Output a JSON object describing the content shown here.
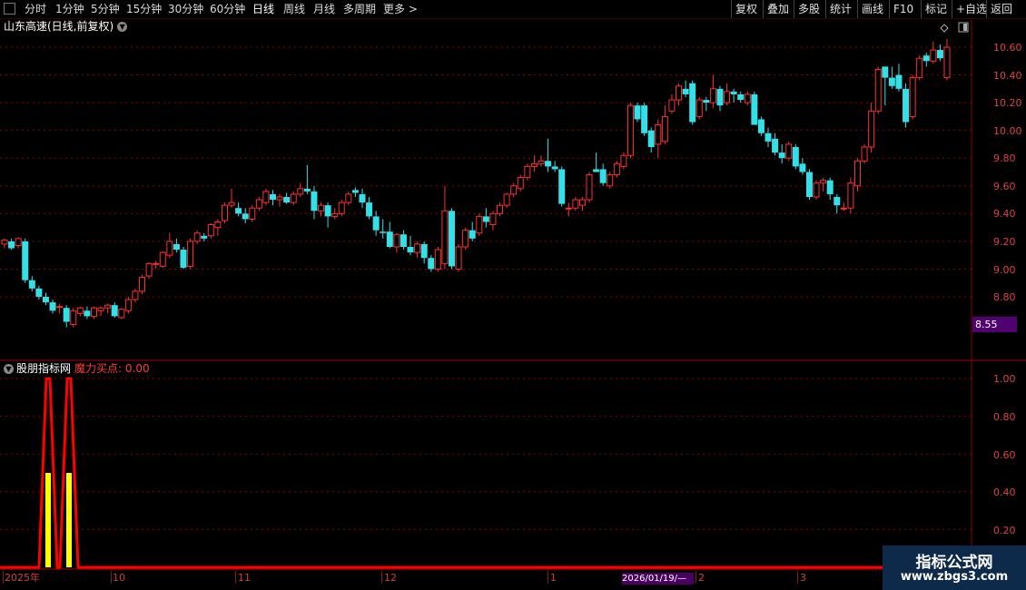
{
  "toolbar": {
    "periods": [
      "分时",
      "1分钟",
      "5分钟",
      "15分钟",
      "30分钟",
      "60分钟",
      "日线",
      "周线",
      "月线",
      "多周期",
      "更多 >"
    ],
    "active_period": "日线",
    "right_buttons": [
      "复权",
      "叠加",
      "多股",
      "统计",
      "画线",
      "F10",
      "标记",
      "+自选",
      "返回"
    ]
  },
  "main_panel": {
    "title": "山东高速(日线,前复权)",
    "price_tag": "8.55",
    "y_labels": [
      "10.60",
      "10.40",
      "10.20",
      "10.00",
      "9.80",
      "9.60",
      "9.40",
      "9.20",
      "9.00",
      "8.80"
    ]
  },
  "indicator_panel": {
    "name": "股朋指标网",
    "value_label": "魔力买点: 0.00",
    "y_labels": [
      "1.00",
      "0.80",
      "0.60",
      "0.40",
      "0.20"
    ]
  },
  "timeline": {
    "labels": [
      "2025年",
      "10",
      "11",
      "12",
      "1",
      "2",
      "3"
    ],
    "cursor_date": "2026/01/19/—"
  },
  "watermark": {
    "brand": "指标公式网",
    "site": "www.zbgs3.com"
  },
  "colors": {
    "up": "#ff3030",
    "down": "#33e0e8",
    "grid": "#8b0000",
    "signal": "#ff0000",
    "signal_fill": "#ffff00"
  },
  "chart_data": {
    "type": "candlestick",
    "price_range": [
      8.55,
      10.7
    ],
    "candles": [
      {
        "o": 9.18,
        "h": 9.22,
        "l": 9.15,
        "c": 9.21
      },
      {
        "o": 9.2,
        "h": 9.22,
        "l": 9.14,
        "c": 9.15
      },
      {
        "o": 9.17,
        "h": 9.23,
        "l": 9.15,
        "c": 9.22
      },
      {
        "o": 9.2,
        "h": 9.22,
        "l": 8.9,
        "c": 8.92
      },
      {
        "o": 8.92,
        "h": 8.95,
        "l": 8.84,
        "c": 8.86
      },
      {
        "o": 8.86,
        "h": 8.88,
        "l": 8.78,
        "c": 8.8
      },
      {
        "o": 8.8,
        "h": 8.83,
        "l": 8.74,
        "c": 8.76
      },
      {
        "o": 8.76,
        "h": 8.78,
        "l": 8.68,
        "c": 8.7
      },
      {
        "o": 8.73,
        "h": 8.75,
        "l": 8.68,
        "c": 8.73
      },
      {
        "o": 8.72,
        "h": 8.74,
        "l": 8.58,
        "c": 8.62
      },
      {
        "o": 8.6,
        "h": 8.72,
        "l": 8.58,
        "c": 8.7
      },
      {
        "o": 8.68,
        "h": 8.73,
        "l": 8.66,
        "c": 8.72
      },
      {
        "o": 8.7,
        "h": 8.73,
        "l": 8.64,
        "c": 8.66
      },
      {
        "o": 8.66,
        "h": 8.73,
        "l": 8.64,
        "c": 8.72
      },
      {
        "o": 8.7,
        "h": 8.73,
        "l": 8.66,
        "c": 8.72
      },
      {
        "o": 8.72,
        "h": 8.75,
        "l": 8.68,
        "c": 8.74
      },
      {
        "o": 8.74,
        "h": 8.76,
        "l": 8.65,
        "c": 8.66
      },
      {
        "o": 8.65,
        "h": 8.72,
        "l": 8.64,
        "c": 8.71
      },
      {
        "o": 8.7,
        "h": 8.8,
        "l": 8.68,
        "c": 8.78
      },
      {
        "o": 8.78,
        "h": 8.86,
        "l": 8.76,
        "c": 8.84
      },
      {
        "o": 8.84,
        "h": 8.96,
        "l": 8.82,
        "c": 8.94
      },
      {
        "o": 8.95,
        "h": 9.05,
        "l": 8.93,
        "c": 9.04
      },
      {
        "o": 9.04,
        "h": 9.06,
        "l": 9.0,
        "c": 9.04
      },
      {
        "o": 9.02,
        "h": 9.13,
        "l": 9.01,
        "c": 9.12
      },
      {
        "o": 9.1,
        "h": 9.26,
        "l": 9.08,
        "c": 9.2
      },
      {
        "o": 9.18,
        "h": 9.22,
        "l": 9.12,
        "c": 9.14
      },
      {
        "o": 9.14,
        "h": 9.16,
        "l": 9.0,
        "c": 9.01
      },
      {
        "o": 9.02,
        "h": 9.22,
        "l": 9.0,
        "c": 9.2
      },
      {
        "o": 9.2,
        "h": 9.28,
        "l": 9.18,
        "c": 9.26
      },
      {
        "o": 9.24,
        "h": 9.26,
        "l": 9.2,
        "c": 9.22
      },
      {
        "o": 9.24,
        "h": 9.33,
        "l": 9.22,
        "c": 9.32
      },
      {
        "o": 9.3,
        "h": 9.36,
        "l": 9.24,
        "c": 9.34
      },
      {
        "o": 9.35,
        "h": 9.48,
        "l": 9.33,
        "c": 9.46
      },
      {
        "o": 9.46,
        "h": 9.58,
        "l": 9.44,
        "c": 9.48
      },
      {
        "o": 9.44,
        "h": 9.48,
        "l": 9.38,
        "c": 9.4
      },
      {
        "o": 9.4,
        "h": 9.44,
        "l": 9.33,
        "c": 9.36
      },
      {
        "o": 9.36,
        "h": 9.46,
        "l": 9.34,
        "c": 9.44
      },
      {
        "o": 9.44,
        "h": 9.52,
        "l": 9.42,
        "c": 9.5
      },
      {
        "o": 9.48,
        "h": 9.58,
        "l": 9.46,
        "c": 9.56
      },
      {
        "o": 9.54,
        "h": 9.57,
        "l": 9.46,
        "c": 9.5
      },
      {
        "o": 9.5,
        "h": 9.54,
        "l": 9.45,
        "c": 9.52
      },
      {
        "o": 9.52,
        "h": 9.55,
        "l": 9.47,
        "c": 9.48
      },
      {
        "o": 9.48,
        "h": 9.56,
        "l": 9.46,
        "c": 9.54
      },
      {
        "o": 9.54,
        "h": 9.62,
        "l": 9.52,
        "c": 9.58
      },
      {
        "o": 9.58,
        "h": 9.75,
        "l": 9.54,
        "c": 9.56
      },
      {
        "o": 9.56,
        "h": 9.6,
        "l": 9.36,
        "c": 9.42
      },
      {
        "o": 9.42,
        "h": 9.48,
        "l": 9.38,
        "c": 9.46
      },
      {
        "o": 9.46,
        "h": 9.48,
        "l": 9.3,
        "c": 9.38
      },
      {
        "o": 9.38,
        "h": 9.44,
        "l": 9.36,
        "c": 9.4
      },
      {
        "o": 9.4,
        "h": 9.5,
        "l": 9.38,
        "c": 9.48
      },
      {
        "o": 9.48,
        "h": 9.56,
        "l": 9.46,
        "c": 9.54
      },
      {
        "o": 9.57,
        "h": 9.59,
        "l": 9.52,
        "c": 9.55
      },
      {
        "o": 9.54,
        "h": 9.58,
        "l": 9.44,
        "c": 9.48
      },
      {
        "o": 9.48,
        "h": 9.52,
        "l": 9.36,
        "c": 9.38
      },
      {
        "o": 9.38,
        "h": 9.42,
        "l": 9.24,
        "c": 9.28
      },
      {
        "o": 9.27,
        "h": 9.36,
        "l": 9.22,
        "c": 9.26
      },
      {
        "o": 9.27,
        "h": 9.34,
        "l": 9.15,
        "c": 9.16
      },
      {
        "o": 9.16,
        "h": 9.26,
        "l": 9.12,
        "c": 9.25
      },
      {
        "o": 9.25,
        "h": 9.28,
        "l": 9.14,
        "c": 9.16
      },
      {
        "o": 9.16,
        "h": 9.24,
        "l": 9.1,
        "c": 9.12
      },
      {
        "o": 9.12,
        "h": 9.2,
        "l": 9.08,
        "c": 9.18
      },
      {
        "o": 9.18,
        "h": 9.2,
        "l": 9.04,
        "c": 9.08
      },
      {
        "o": 9.08,
        "h": 9.1,
        "l": 8.98,
        "c": 9.0
      },
      {
        "o": 9.0,
        "h": 9.16,
        "l": 8.98,
        "c": 9.14
      },
      {
        "o": 9.04,
        "h": 9.6,
        "l": 9.0,
        "c": 9.42
      },
      {
        "o": 9.42,
        "h": 9.44,
        "l": 9.0,
        "c": 9.02
      },
      {
        "o": 9.0,
        "h": 9.18,
        "l": 8.98,
        "c": 9.16
      },
      {
        "o": 9.16,
        "h": 9.3,
        "l": 9.14,
        "c": 9.28
      },
      {
        "o": 9.28,
        "h": 9.34,
        "l": 9.2,
        "c": 9.22
      },
      {
        "o": 9.26,
        "h": 9.4,
        "l": 9.24,
        "c": 9.38
      },
      {
        "o": 9.38,
        "h": 9.44,
        "l": 9.3,
        "c": 9.34
      },
      {
        "o": 9.32,
        "h": 9.42,
        "l": 9.28,
        "c": 9.4
      },
      {
        "o": 9.4,
        "h": 9.48,
        "l": 9.38,
        "c": 9.46
      },
      {
        "o": 9.46,
        "h": 9.55,
        "l": 9.44,
        "c": 9.54
      },
      {
        "o": 9.54,
        "h": 9.62,
        "l": 9.52,
        "c": 9.6
      },
      {
        "o": 9.58,
        "h": 9.68,
        "l": 9.56,
        "c": 9.66
      },
      {
        "o": 9.66,
        "h": 9.76,
        "l": 9.64,
        "c": 9.74
      },
      {
        "o": 9.74,
        "h": 9.82,
        "l": 9.7,
        "c": 9.76
      },
      {
        "o": 9.76,
        "h": 9.82,
        "l": 9.74,
        "c": 9.78
      },
      {
        "o": 9.78,
        "h": 9.94,
        "l": 9.7,
        "c": 9.74
      },
      {
        "o": 9.74,
        "h": 9.78,
        "l": 9.7,
        "c": 9.72
      },
      {
        "o": 9.72,
        "h": 9.74,
        "l": 9.45,
        "c": 9.47
      },
      {
        "o": 9.44,
        "h": 9.48,
        "l": 9.38,
        "c": 9.44
      },
      {
        "o": 9.44,
        "h": 9.52,
        "l": 9.42,
        "c": 9.5
      },
      {
        "o": 9.46,
        "h": 9.52,
        "l": 9.42,
        "c": 9.5
      },
      {
        "o": 9.5,
        "h": 9.7,
        "l": 9.48,
        "c": 9.68
      },
      {
        "o": 9.72,
        "h": 9.84,
        "l": 9.7,
        "c": 9.7
      },
      {
        "o": 9.72,
        "h": 9.76,
        "l": 9.6,
        "c": 9.62
      },
      {
        "o": 9.6,
        "h": 9.7,
        "l": 9.58,
        "c": 9.68
      },
      {
        "o": 9.68,
        "h": 9.78,
        "l": 9.66,
        "c": 9.76
      },
      {
        "o": 9.74,
        "h": 9.84,
        "l": 9.72,
        "c": 9.82
      },
      {
        "o": 9.82,
        "h": 10.2,
        "l": 9.8,
        "c": 10.18
      },
      {
        "o": 10.18,
        "h": 10.2,
        "l": 10.06,
        "c": 10.08
      },
      {
        "o": 10.18,
        "h": 10.2,
        "l": 9.96,
        "c": 9.98
      },
      {
        "o": 10.0,
        "h": 10.02,
        "l": 9.84,
        "c": 9.88
      },
      {
        "o": 9.9,
        "h": 10.08,
        "l": 9.8,
        "c": 10.04
      },
      {
        "o": 9.92,
        "h": 10.18,
        "l": 9.9,
        "c": 10.1
      },
      {
        "o": 10.14,
        "h": 10.26,
        "l": 10.12,
        "c": 10.22
      },
      {
        "o": 10.22,
        "h": 10.34,
        "l": 10.18,
        "c": 10.32
      },
      {
        "o": 10.3,
        "h": 10.36,
        "l": 10.24,
        "c": 10.26
      },
      {
        "o": 10.34,
        "h": 10.36,
        "l": 10.04,
        "c": 10.06
      },
      {
        "o": 10.1,
        "h": 10.24,
        "l": 10.08,
        "c": 10.22
      },
      {
        "o": 10.22,
        "h": 10.24,
        "l": 10.14,
        "c": 10.2
      },
      {
        "o": 10.2,
        "h": 10.4,
        "l": 10.16,
        "c": 10.3
      },
      {
        "o": 10.3,
        "h": 10.32,
        "l": 10.14,
        "c": 10.18
      },
      {
        "o": 10.2,
        "h": 10.34,
        "l": 10.18,
        "c": 10.28
      },
      {
        "o": 10.28,
        "h": 10.3,
        "l": 10.2,
        "c": 10.26
      },
      {
        "o": 10.26,
        "h": 10.28,
        "l": 10.2,
        "c": 10.22
      },
      {
        "o": 10.2,
        "h": 10.28,
        "l": 10.18,
        "c": 10.26
      },
      {
        "o": 10.26,
        "h": 10.28,
        "l": 10.08,
        "c": 10.04
      },
      {
        "o": 10.08,
        "h": 10.1,
        "l": 9.96,
        "c": 9.98
      },
      {
        "o": 9.98,
        "h": 10.02,
        "l": 9.88,
        "c": 9.92
      },
      {
        "o": 9.94,
        "h": 9.98,
        "l": 9.82,
        "c": 9.84
      },
      {
        "o": 9.84,
        "h": 9.9,
        "l": 9.76,
        "c": 9.8
      },
      {
        "o": 9.8,
        "h": 9.92,
        "l": 9.78,
        "c": 9.9
      },
      {
        "o": 9.88,
        "h": 9.9,
        "l": 9.72,
        "c": 9.74
      },
      {
        "o": 9.76,
        "h": 9.8,
        "l": 9.68,
        "c": 9.7
      },
      {
        "o": 9.7,
        "h": 9.72,
        "l": 9.5,
        "c": 9.52
      },
      {
        "o": 9.52,
        "h": 9.64,
        "l": 9.5,
        "c": 9.62
      },
      {
        "o": 9.62,
        "h": 9.66,
        "l": 9.56,
        "c": 9.64
      },
      {
        "o": 9.64,
        "h": 9.66,
        "l": 9.5,
        "c": 9.54
      },
      {
        "o": 9.52,
        "h": 9.54,
        "l": 9.4,
        "c": 9.46
      },
      {
        "o": 9.44,
        "h": 9.48,
        "l": 9.42,
        "c": 9.44
      },
      {
        "o": 9.44,
        "h": 9.66,
        "l": 9.4,
        "c": 9.62
      },
      {
        "o": 9.6,
        "h": 9.8,
        "l": 9.56,
        "c": 9.78
      },
      {
        "o": 9.78,
        "h": 9.9,
        "l": 9.76,
        "c": 9.88
      },
      {
        "o": 9.88,
        "h": 10.2,
        "l": 9.84,
        "c": 10.14
      },
      {
        "o": 10.14,
        "h": 10.46,
        "l": 10.12,
        "c": 10.44
      },
      {
        "o": 10.46,
        "h": 10.4,
        "l": 10.18,
        "c": 10.38
      },
      {
        "o": 10.38,
        "h": 10.46,
        "l": 10.3,
        "c": 10.32
      },
      {
        "o": 10.4,
        "h": 10.48,
        "l": 10.28,
        "c": 10.3
      },
      {
        "o": 10.3,
        "h": 10.34,
        "l": 10.02,
        "c": 10.06
      },
      {
        "o": 10.1,
        "h": 10.4,
        "l": 10.08,
        "c": 10.38
      },
      {
        "o": 10.38,
        "h": 10.54,
        "l": 10.36,
        "c": 10.52
      },
      {
        "o": 10.54,
        "h": 10.56,
        "l": 10.46,
        "c": 10.5
      },
      {
        "o": 10.5,
        "h": 10.64,
        "l": 10.48,
        "c": 10.58
      },
      {
        "o": 10.58,
        "h": 10.62,
        "l": 10.5,
        "c": 10.52
      },
      {
        "o": 10.38,
        "h": 10.66,
        "l": 10.36,
        "c": 10.6
      }
    ],
    "indicator": {
      "name": "魔力买点",
      "ylim": [
        0,
        1
      ],
      "signals": [
        {
          "candle_index": 2,
          "value": 1.0,
          "fill": 0.5
        },
        {
          "candle_index": 5,
          "value": 1.0,
          "fill": 0.5
        }
      ]
    }
  }
}
